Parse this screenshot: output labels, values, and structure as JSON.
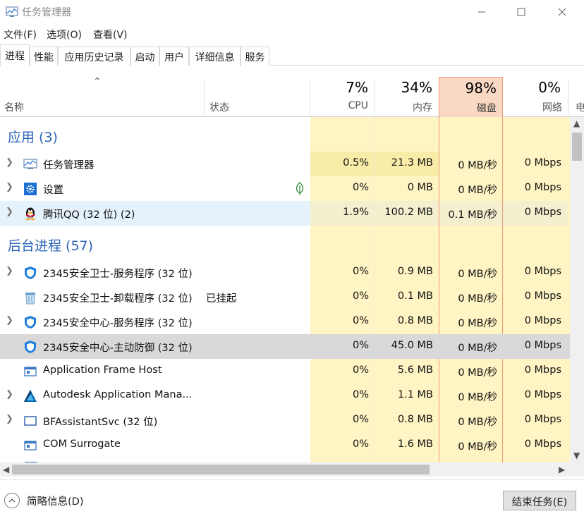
{
  "window": {
    "title": "任务管理器"
  },
  "menu": [
    "文件(F)",
    "选项(O)",
    "查看(V)"
  ],
  "tabs": [
    "进程",
    "性能",
    "应用历史记录",
    "启动",
    "用户",
    "详细信息",
    "服务"
  ],
  "header": {
    "name_label": "名称",
    "status_label": "状态",
    "cpu": {
      "pct": "7%",
      "label": "CPU"
    },
    "mem": {
      "pct": "34%",
      "label": "内存"
    },
    "disk": {
      "pct": "98%",
      "label": "磁盘"
    },
    "net": {
      "pct": "0%",
      "label": "网络"
    },
    "extra_label": "电"
  },
  "groups": {
    "apps": "应用 (3)",
    "background": "后台进程 (57)"
  },
  "rows": [
    {
      "name": "任务管理器",
      "status": "",
      "cpu": "0.5%",
      "mem": "21.3 MB",
      "disk": "0 MB/秒",
      "net": "0 Mbps",
      "icon": "task-manager-icon"
    },
    {
      "name": "设置",
      "status": "",
      "cpu": "0%",
      "mem": "0 MB",
      "disk": "0 MB/秒",
      "net": "0 Mbps",
      "icon": "settings-gear-icon"
    },
    {
      "name": "腾讯QQ (32 位) (2)",
      "status": "",
      "cpu": "1.9%",
      "mem": "100.2 MB",
      "disk": "0.1 MB/秒",
      "net": "0 Mbps",
      "icon": "qq-penguin-icon"
    },
    {
      "name": "2345安全卫士-服务程序 (32 位)",
      "status": "",
      "cpu": "0%",
      "mem": "0.9 MB",
      "disk": "0 MB/秒",
      "net": "0 Mbps",
      "icon": "shield-icon"
    },
    {
      "name": "2345安全卫士-卸载程序 (32 位)",
      "status": "已挂起",
      "cpu": "0%",
      "mem": "0.1 MB",
      "disk": "0 MB/秒",
      "net": "0 Mbps",
      "icon": "recycle-bin-icon"
    },
    {
      "name": "2345安全中心-服务程序 (32 位)",
      "status": "",
      "cpu": "0%",
      "mem": "0.8 MB",
      "disk": "0 MB/秒",
      "net": "0 Mbps",
      "icon": "shield-icon"
    },
    {
      "name": "2345安全中心-主动防御 (32 位)",
      "status": "",
      "cpu": "0%",
      "mem": "45.0 MB",
      "disk": "0 MB/秒",
      "net": "0 Mbps",
      "icon": "shield-icon"
    },
    {
      "name": "Application Frame Host",
      "status": "",
      "cpu": "0%",
      "mem": "5.6 MB",
      "disk": "0 MB/秒",
      "net": "0 Mbps",
      "icon": "app-window-icon"
    },
    {
      "name": "Autodesk Application Mana...",
      "status": "",
      "cpu": "0%",
      "mem": "1.1 MB",
      "disk": "0 MB/秒",
      "net": "0 Mbps",
      "icon": "autodesk-logo-icon"
    },
    {
      "name": "BFAssistantSvc (32 位)",
      "status": "",
      "cpu": "0%",
      "mem": "0.8 MB",
      "disk": "0 MB/秒",
      "net": "0 Mbps",
      "icon": "window-frame-icon"
    },
    {
      "name": "COM Surrogate",
      "status": "",
      "cpu": "0%",
      "mem": "1.6 MB",
      "disk": "0 MB/秒",
      "net": "0 Mbps",
      "icon": "app-window-icon"
    }
  ],
  "footer": {
    "fewer_details": "简略信息(D)",
    "end_task": "结束任务(E)"
  },
  "colors": {
    "heat_light": "#fff4c4",
    "heat_mid": "#f9eca8",
    "disk_header": "#f9d9c4",
    "disk_border": "#f09a7a",
    "group_title": "#2b64b8",
    "selected_row": "#d9d9d9",
    "hover_row": "#e5f1fb"
  }
}
